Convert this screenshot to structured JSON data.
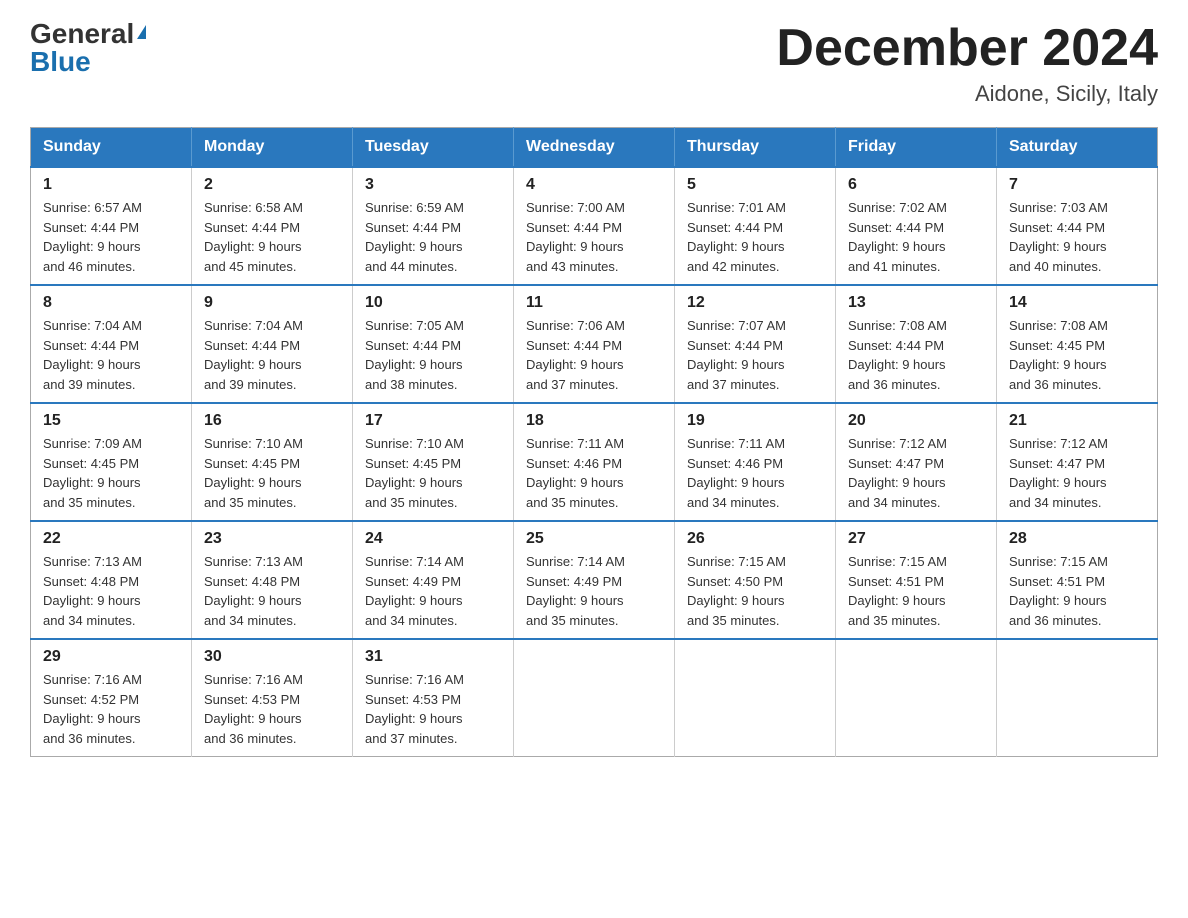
{
  "logo": {
    "general": "General",
    "blue": "Blue",
    "triangle": "▲"
  },
  "header": {
    "month_title": "December 2024",
    "location": "Aidone, Sicily, Italy"
  },
  "days_of_week": [
    "Sunday",
    "Monday",
    "Tuesday",
    "Wednesday",
    "Thursday",
    "Friday",
    "Saturday"
  ],
  "weeks": [
    [
      {
        "day": "1",
        "sunrise": "6:57 AM",
        "sunset": "4:44 PM",
        "daylight": "9 hours and 46 minutes."
      },
      {
        "day": "2",
        "sunrise": "6:58 AM",
        "sunset": "4:44 PM",
        "daylight": "9 hours and 45 minutes."
      },
      {
        "day": "3",
        "sunrise": "6:59 AM",
        "sunset": "4:44 PM",
        "daylight": "9 hours and 44 minutes."
      },
      {
        "day": "4",
        "sunrise": "7:00 AM",
        "sunset": "4:44 PM",
        "daylight": "9 hours and 43 minutes."
      },
      {
        "day": "5",
        "sunrise": "7:01 AM",
        "sunset": "4:44 PM",
        "daylight": "9 hours and 42 minutes."
      },
      {
        "day": "6",
        "sunrise": "7:02 AM",
        "sunset": "4:44 PM",
        "daylight": "9 hours and 41 minutes."
      },
      {
        "day": "7",
        "sunrise": "7:03 AM",
        "sunset": "4:44 PM",
        "daylight": "9 hours and 40 minutes."
      }
    ],
    [
      {
        "day": "8",
        "sunrise": "7:04 AM",
        "sunset": "4:44 PM",
        "daylight": "9 hours and 39 minutes."
      },
      {
        "day": "9",
        "sunrise": "7:04 AM",
        "sunset": "4:44 PM",
        "daylight": "9 hours and 39 minutes."
      },
      {
        "day": "10",
        "sunrise": "7:05 AM",
        "sunset": "4:44 PM",
        "daylight": "9 hours and 38 minutes."
      },
      {
        "day": "11",
        "sunrise": "7:06 AM",
        "sunset": "4:44 PM",
        "daylight": "9 hours and 37 minutes."
      },
      {
        "day": "12",
        "sunrise": "7:07 AM",
        "sunset": "4:44 PM",
        "daylight": "9 hours and 37 minutes."
      },
      {
        "day": "13",
        "sunrise": "7:08 AM",
        "sunset": "4:44 PM",
        "daylight": "9 hours and 36 minutes."
      },
      {
        "day": "14",
        "sunrise": "7:08 AM",
        "sunset": "4:45 PM",
        "daylight": "9 hours and 36 minutes."
      }
    ],
    [
      {
        "day": "15",
        "sunrise": "7:09 AM",
        "sunset": "4:45 PM",
        "daylight": "9 hours and 35 minutes."
      },
      {
        "day": "16",
        "sunrise": "7:10 AM",
        "sunset": "4:45 PM",
        "daylight": "9 hours and 35 minutes."
      },
      {
        "day": "17",
        "sunrise": "7:10 AM",
        "sunset": "4:45 PM",
        "daylight": "9 hours and 35 minutes."
      },
      {
        "day": "18",
        "sunrise": "7:11 AM",
        "sunset": "4:46 PM",
        "daylight": "9 hours and 35 minutes."
      },
      {
        "day": "19",
        "sunrise": "7:11 AM",
        "sunset": "4:46 PM",
        "daylight": "9 hours and 34 minutes."
      },
      {
        "day": "20",
        "sunrise": "7:12 AM",
        "sunset": "4:47 PM",
        "daylight": "9 hours and 34 minutes."
      },
      {
        "day": "21",
        "sunrise": "7:12 AM",
        "sunset": "4:47 PM",
        "daylight": "9 hours and 34 minutes."
      }
    ],
    [
      {
        "day": "22",
        "sunrise": "7:13 AM",
        "sunset": "4:48 PM",
        "daylight": "9 hours and 34 minutes."
      },
      {
        "day": "23",
        "sunrise": "7:13 AM",
        "sunset": "4:48 PM",
        "daylight": "9 hours and 34 minutes."
      },
      {
        "day": "24",
        "sunrise": "7:14 AM",
        "sunset": "4:49 PM",
        "daylight": "9 hours and 34 minutes."
      },
      {
        "day": "25",
        "sunrise": "7:14 AM",
        "sunset": "4:49 PM",
        "daylight": "9 hours and 35 minutes."
      },
      {
        "day": "26",
        "sunrise": "7:15 AM",
        "sunset": "4:50 PM",
        "daylight": "9 hours and 35 minutes."
      },
      {
        "day": "27",
        "sunrise": "7:15 AM",
        "sunset": "4:51 PM",
        "daylight": "9 hours and 35 minutes."
      },
      {
        "day": "28",
        "sunrise": "7:15 AM",
        "sunset": "4:51 PM",
        "daylight": "9 hours and 36 minutes."
      }
    ],
    [
      {
        "day": "29",
        "sunrise": "7:16 AM",
        "sunset": "4:52 PM",
        "daylight": "9 hours and 36 minutes."
      },
      {
        "day": "30",
        "sunrise": "7:16 AM",
        "sunset": "4:53 PM",
        "daylight": "9 hours and 36 minutes."
      },
      {
        "day": "31",
        "sunrise": "7:16 AM",
        "sunset": "4:53 PM",
        "daylight": "9 hours and 37 minutes."
      },
      null,
      null,
      null,
      null
    ]
  ],
  "labels": {
    "sunrise": "Sunrise:",
    "sunset": "Sunset:",
    "daylight": "Daylight:"
  }
}
